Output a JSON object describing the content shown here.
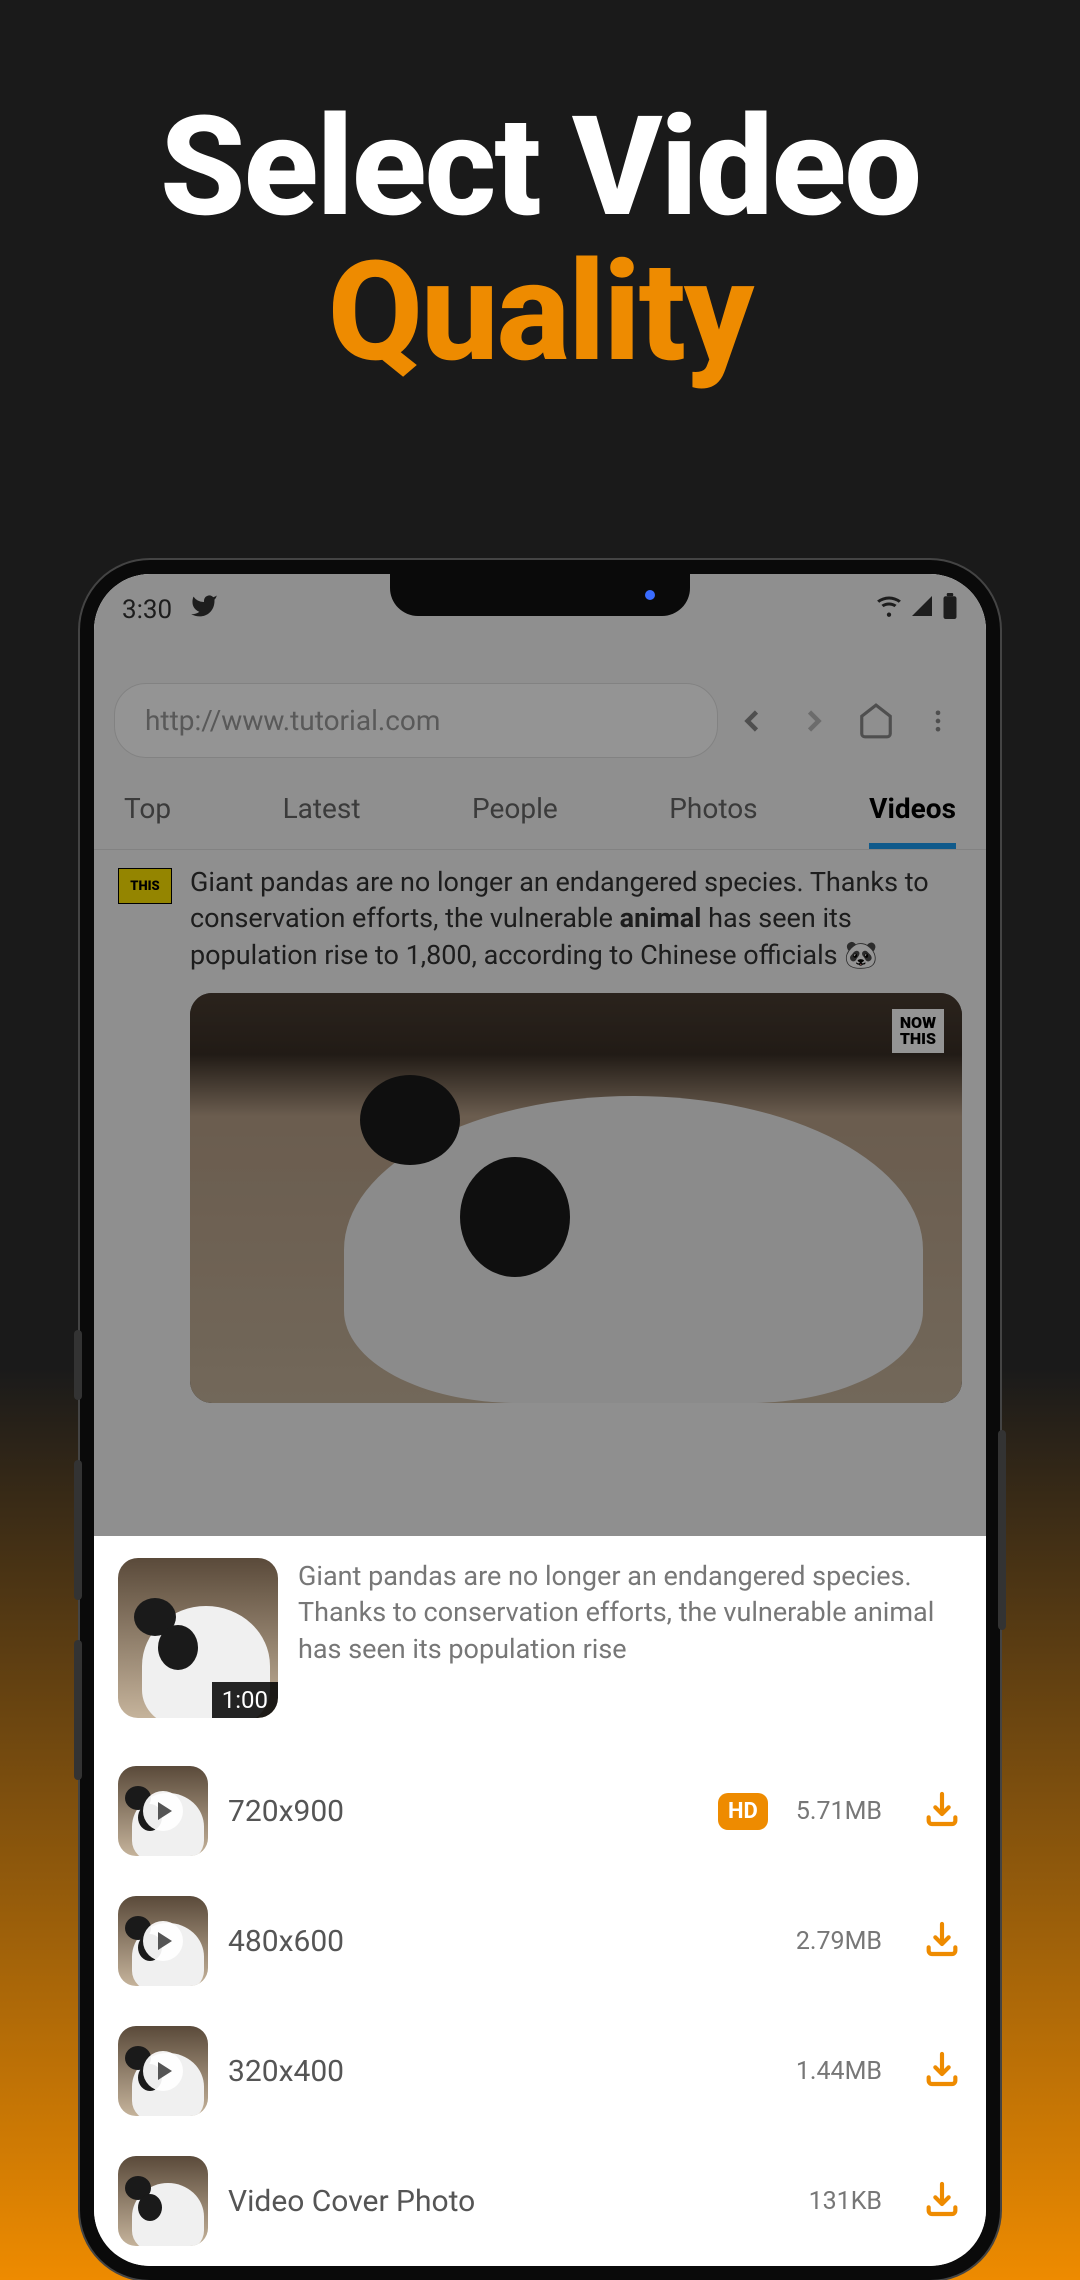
{
  "hero": {
    "line1": "Select Video",
    "line2": "Quality"
  },
  "status": {
    "time": "3:30"
  },
  "urlbar": {
    "url": "http://www.tutorial.com"
  },
  "tabs": [
    {
      "label": "Top"
    },
    {
      "label": "Latest"
    },
    {
      "label": "People"
    },
    {
      "label": "Photos"
    },
    {
      "label": "Videos"
    }
  ],
  "post": {
    "avatar_text": "THIS",
    "text_before": "Giant pandas are no longer an endangered species. Thanks to conservation efforts, the vulnerable ",
    "text_bold": "animal",
    "text_after": " has seen its population rise to 1,800, according to Chinese officials 🐼",
    "embed_badge_top": "NOW",
    "embed_badge_bottom": "THIS"
  },
  "sheet": {
    "thumb_time": "1:00",
    "description": "Giant pandas are no longer an endangered species. Thanks to conservation efforts, the vulnerable animal has seen its population rise",
    "hd_label": "HD",
    "qualities": [
      {
        "label": "720x900",
        "size": "5.71MB",
        "hd": true
      },
      {
        "label": "480x600",
        "size": "2.79MB",
        "hd": false
      },
      {
        "label": "320x400",
        "size": "1.44MB",
        "hd": false
      },
      {
        "label": "Video Cover Photo",
        "size": "131KB",
        "hd": false
      }
    ]
  }
}
